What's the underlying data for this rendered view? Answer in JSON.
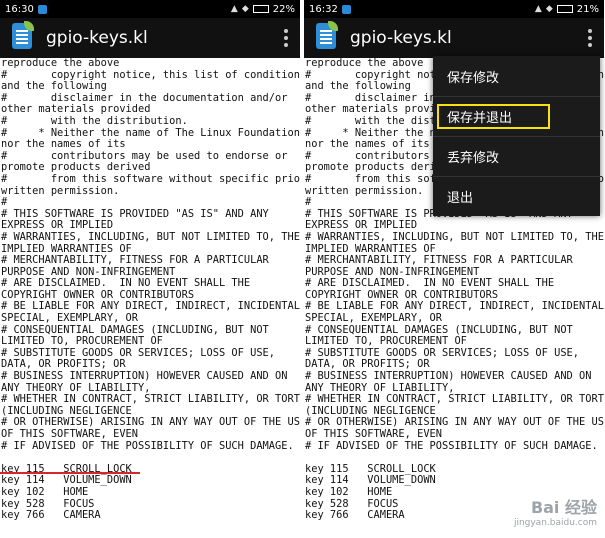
{
  "left_screen": {
    "status_time": "16:30",
    "battery": "22%",
    "app_title": "gpio-keys.kl"
  },
  "right_screen": {
    "status_time": "16:32",
    "battery": "21%",
    "app_title": "gpio-keys.kl"
  },
  "file_lines": [
    "reproduce the above",
    "#       copyright notice, this list of conditions",
    "and the following",
    "#       disclaimer in the documentation and/or",
    "other materials provided",
    "#       with the distribution.",
    "#     * Neither the name of The Linux Foundation",
    "nor the names of its",
    "#       contributors may be used to endorse or",
    "promote products derived",
    "#       from this software without specific prior",
    "written permission.",
    "#",
    "# THIS SOFTWARE IS PROVIDED \"AS IS\" AND ANY",
    "EXPRESS OR IMPLIED",
    "# WARRANTIES, INCLUDING, BUT NOT LIMITED TO, THE",
    "IMPLIED WARRANTIES OF",
    "# MERCHANTABILITY, FITNESS FOR A PARTICULAR",
    "PURPOSE AND NON-INFRINGEMENT",
    "# ARE DISCLAIMED.  IN NO EVENT SHALL THE",
    "COPYRIGHT OWNER OR CONTRIBUTORS",
    "# BE LIABLE FOR ANY DIRECT, INDIRECT, INCIDENTAL,",
    "SPECIAL, EXEMPLARY, OR",
    "# CONSEQUENTIAL DAMAGES (INCLUDING, BUT NOT",
    "LIMITED TO, PROCUREMENT OF",
    "# SUBSTITUTE GOODS OR SERVICES; LOSS OF USE,",
    "DATA, OR PROFITS; OR",
    "# BUSINESS INTERRUPTION) HOWEVER CAUSED AND ON",
    "ANY THEORY OF LIABILITY,",
    "# WHETHER IN CONTRACT, STRICT LIABILITY, OR TORT",
    "(INCLUDING NEGLIGENCE",
    "# OR OTHERWISE) ARISING IN ANY WAY OUT OF THE USE",
    "OF THIS SOFTWARE, EVEN",
    "# IF ADVISED OF THE POSSIBILITY OF SUCH DAMAGE.",
    "",
    "key 115   SCROLL_LOCK",
    "key 114   VOLUME_DOWN",
    "key 102   HOME",
    "key 528   FOCUS",
    "key 766   CAMERA"
  ],
  "overflow_menu": {
    "items": [
      "保存修改",
      "保存并退出",
      "丢弃修改",
      "退出"
    ]
  },
  "watermark": {
    "logo": "Bai 经验",
    "url": "jingyan.baidu.com"
  },
  "colors": {
    "status_bar": "#000000",
    "app_bar": "#111111",
    "menu_bg": "#1b1b1b",
    "highlight": "#f5e20e",
    "underline": "#d9262c"
  }
}
